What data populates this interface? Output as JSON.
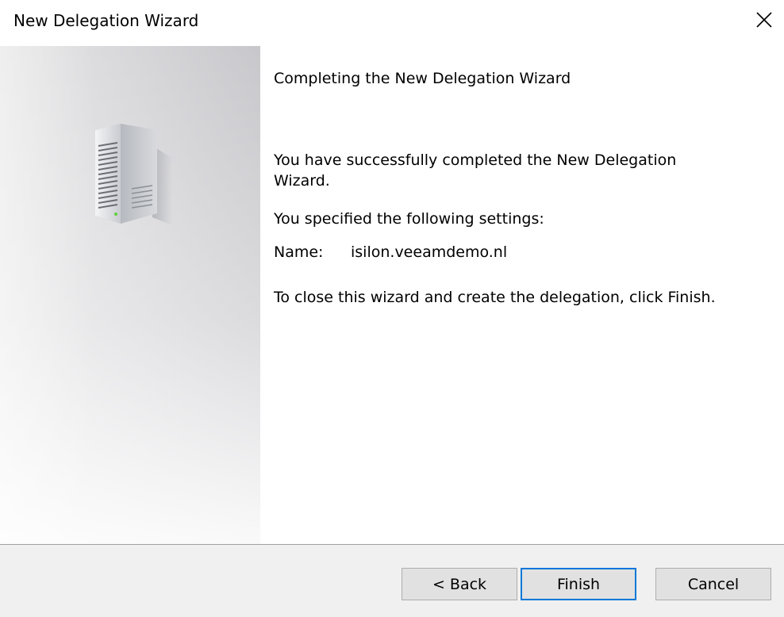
{
  "window": {
    "title": "New Delegation Wizard"
  },
  "icons": {
    "close": "close-icon",
    "side_image": "server-icon"
  },
  "content": {
    "heading": "Completing the New Delegation Wizard",
    "success_text": "You have successfully completed the New Delegation Wizard.",
    "settings_intro": "You specified the following settings:",
    "name_label": "Name:",
    "name_value": "isilon.veeamdemo.nl",
    "finish_instructions": "To close this wizard and create the delegation, click Finish."
  },
  "buttons": {
    "back": "< Back",
    "finish": "Finish",
    "cancel": "Cancel"
  },
  "colors": {
    "focus_border": "#0078d7",
    "footer_bg": "#f0f0f0",
    "button_bg": "#e1e1e1"
  }
}
